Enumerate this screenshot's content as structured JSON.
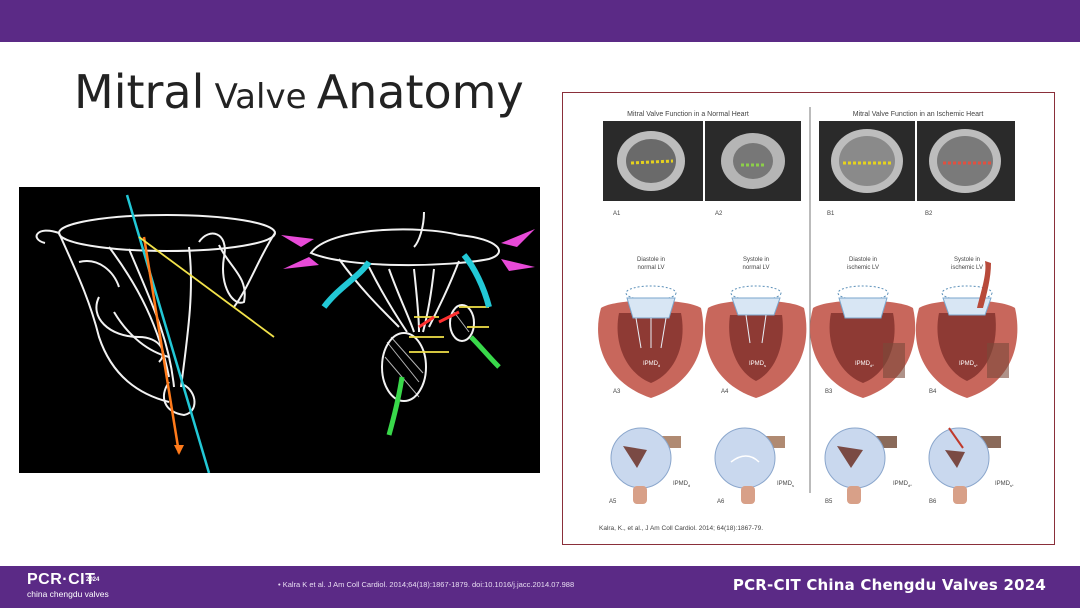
{
  "slide": {
    "title_part1": "Mitral",
    "title_part2": "Valve",
    "title_part3": "Anatomy"
  },
  "figure": {
    "header_left": "Mitral Valve Function in a Normal Heart",
    "header_right": "Mitral Valve Function in an Ischemic Heart",
    "mri_labels": [
      "A1",
      "A2",
      "B1",
      "B2"
    ],
    "heart_captions": [
      [
        "Diastole in",
        "normal LV"
      ],
      [
        "Systole in",
        "normal LV"
      ],
      [
        "Diastole in",
        "ischemic LV"
      ],
      [
        "Systole in",
        "ischemic LV"
      ]
    ],
    "heart_labels": [
      "A3",
      "A4",
      "B3",
      "B4"
    ],
    "heart_ipmd": [
      "IPMD",
      "IPMD",
      "IPMD",
      "IPMD"
    ],
    "heart_ipmd_sub": [
      "d",
      "s",
      "d*",
      "s*"
    ],
    "valve_labels": [
      "A5",
      "A6",
      "B5",
      "B6"
    ],
    "valve_ipmd": [
      "IPMD",
      "IPMD",
      "IPMD",
      "IPMD"
    ],
    "valve_ipmd_sub": [
      "d",
      "s",
      "d*",
      "s*"
    ],
    "source": "Kalra, K., et al., J Am Coll Cardiol. 2014; 64(18):1867-79."
  },
  "footer": {
    "logo_main": "PCR·CIT",
    "logo_year": "2024",
    "logo_sub": "china chengdu valves",
    "citation": "•     Kalra K et al. J Am Coll Cardiol. 2014;64(18):1867-1879. doi:10.1016/j.jacc.2014.07.988",
    "brand": "PCR-CIT China Chengdu Valves 2024"
  },
  "colors": {
    "purple": "#5b2a86",
    "frame_border": "#8a2f3a",
    "title": "#222222"
  }
}
